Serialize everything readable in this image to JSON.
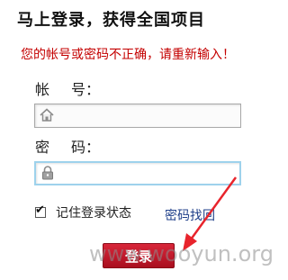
{
  "title": "马上登录，获得全国项目",
  "error_message": "您的帐号或密码不正确，请重新输入！",
  "account": {
    "label_first": "帐",
    "label_second": "号：",
    "value": "",
    "icon": "home-icon"
  },
  "password": {
    "label_first": "密",
    "label_second": "码：",
    "value": "",
    "icon": "lock-icon"
  },
  "remember": {
    "label": "记住登录状态",
    "checked": true
  },
  "forgot_password": "密码找回",
  "login_button": "登录",
  "watermark": "www.wooyun.org",
  "colors": {
    "error": "#c40000",
    "button": "#c01a2c",
    "arrow": "#e8242c",
    "link": "#1f3f8a"
  }
}
